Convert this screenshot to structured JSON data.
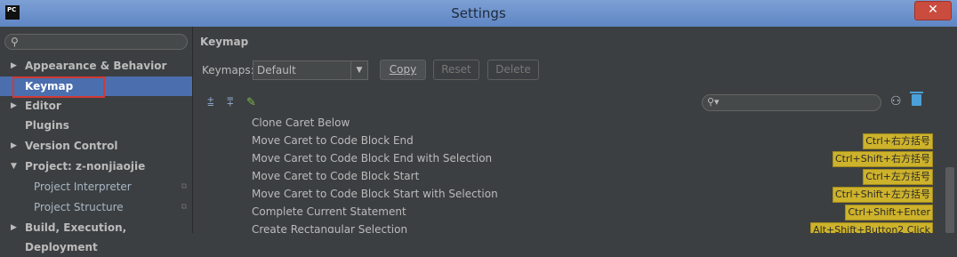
{
  "window": {
    "title": "Settings",
    "close_glyph": "✕",
    "app_icon_text": "PC"
  },
  "sidebar": {
    "search_placeholder": "",
    "items": [
      {
        "label": "Appearance & Behavior",
        "expand": "▶"
      },
      {
        "label": "Keymap",
        "expand": ""
      },
      {
        "label": "Editor",
        "expand": "▶"
      },
      {
        "label": "Plugins",
        "expand": ""
      },
      {
        "label": "Version Control",
        "expand": "▶"
      },
      {
        "label": "Project: z-nonjiaojie",
        "expand": "▼"
      },
      {
        "label": "Project Interpreter",
        "expand": ""
      },
      {
        "label": "Project Structure",
        "expand": ""
      },
      {
        "label": "Build, Execution, Deployment",
        "expand": "▶"
      }
    ],
    "selected": "Keymap"
  },
  "main": {
    "section_title": "Keymap",
    "keymaps_label": "Keymaps:",
    "keymap_value": "Default",
    "buttons": {
      "copy": "Copy",
      "reset": "Reset",
      "delete": "Delete"
    },
    "filter_placeholder": "",
    "actions": [
      {
        "name": "Clone Caret Below",
        "shortcut": ""
      },
      {
        "name": "Move Caret to Code Block End",
        "shortcut": "Ctrl+右方括号"
      },
      {
        "name": "Move Caret to Code Block End with Selection",
        "shortcut": "Ctrl+Shift+右方括号"
      },
      {
        "name": "Move Caret to Code Block Start",
        "shortcut": "Ctrl+左方括号"
      },
      {
        "name": "Move Caret to Code Block Start with Selection",
        "shortcut": "Ctrl+Shift+左方括号"
      },
      {
        "name": "Complete Current Statement",
        "shortcut": "Ctrl+Shift+Enter"
      },
      {
        "name": "Create Rectangular Selection",
        "shortcut": "Alt+Shift+Button2 Click"
      }
    ]
  },
  "icons": {
    "expand_all": "expand-all-icon",
    "collapse_all": "collapse-all-icon",
    "edit": "edit-icon",
    "find_shortcut": "find-by-shortcut-icon",
    "clear": "trash-icon"
  },
  "colors": {
    "selection": "#4b6eaf",
    "shortcut_bg": "#cdb22b",
    "title_bar": "#6f92cc",
    "close": "#c94c3e"
  }
}
